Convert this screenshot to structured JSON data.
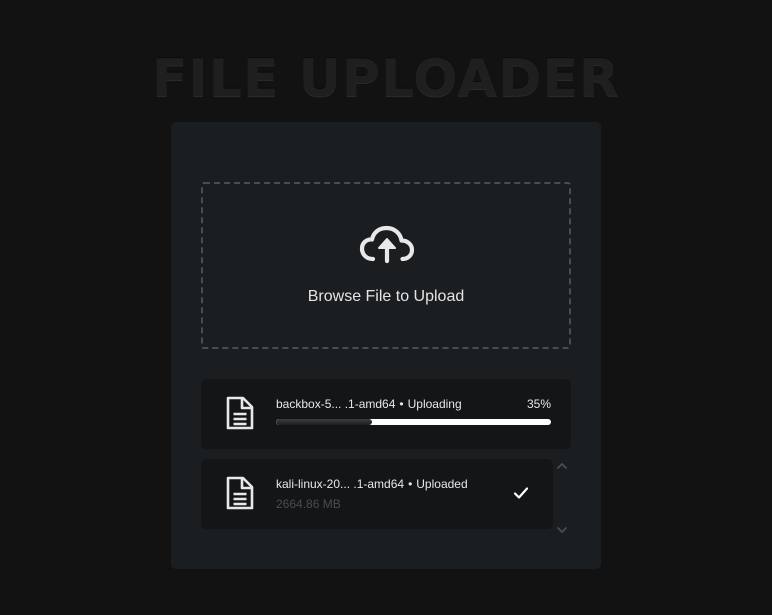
{
  "app": {
    "title": "FILE UPLOADER"
  },
  "dropzone": {
    "label": "Browse File to Upload",
    "icon": "cloud-upload-icon"
  },
  "files": [
    {
      "name": "backbox-5... .1-amd64",
      "status": "Uploading",
      "separator": "•",
      "percent_label": "35%",
      "progress": 0.35,
      "icon": "document-icon"
    },
    {
      "name": "kali-linux-20... .1-amd64",
      "status": "Uploaded",
      "separator": "•",
      "size": "2664.86 MB",
      "icon": "document-icon",
      "status_icon": "check-icon"
    }
  ],
  "colors": {
    "background": "#121212",
    "card": "#1b1e20",
    "file_item": "#131517",
    "text": "#e6e8ea",
    "muted": "#4a4d50",
    "progress": "#ffffff"
  }
}
